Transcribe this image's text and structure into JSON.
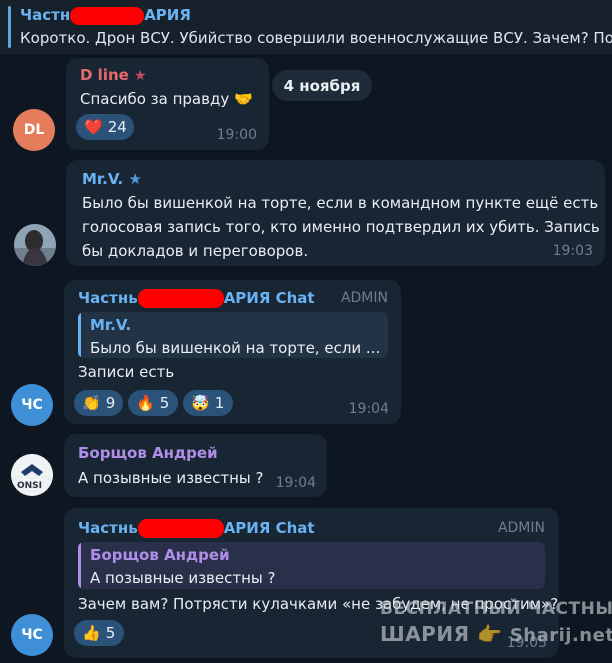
{
  "pinned": {
    "from_left": "Частн",
    "from_right": "АРИЯ",
    "text": "Коротко. Дрон ВСУ. Убийство совершили военнослужащие ВСУ.   Зачем? По"
  },
  "date_pill": "4 ноября",
  "messages": [
    {
      "avatar": "DL",
      "avatar_color": "#e57c5c",
      "sender": "D line",
      "sender_color": "#e86b6b",
      "badge": "★",
      "text": "Спасибо за правду 🤝",
      "reaction_emoji": "❤️",
      "reaction_count": "24",
      "time": "19:00"
    },
    {
      "sender": "Mr.V.",
      "sender_color": "#6ab3f3",
      "badge": "★",
      "text_lines": [
        "Было бы вишенкой на торте, если в командном пункте ещё есть",
        "голосовая запись того, кто именно подтвердил их убить. Запись",
        "бы докладов и переговоров."
      ],
      "time": "19:03"
    },
    {
      "avatar": "ЧС",
      "avatar_color": "#3f8fd6",
      "sender_left": "Частнь",
      "sender_right": "АРИЯ Chat",
      "sender_color": "#6ab3f3",
      "role": "ADMIN",
      "reply_name": "Mr.V.",
      "reply_color": "#6ab3f3",
      "reply_text": "Было бы вишенкой на торте, если ...",
      "text": "Записи есть",
      "reactions": [
        {
          "emoji": "👏",
          "count": "9"
        },
        {
          "emoji": "🔥",
          "count": "5"
        },
        {
          "emoji": "🤯",
          "count": "1"
        }
      ],
      "time": "19:04"
    },
    {
      "sender": "Борщов Андрей",
      "sender_color": "#b08ee8",
      "avatar_text": "ONSI",
      "text": "А позывные известны ?",
      "time": "19:04"
    },
    {
      "avatar": "ЧС",
      "avatar_color": "#3f8fd6",
      "sender_left": "Частнь",
      "sender_right": "АРИЯ Chat",
      "sender_color": "#6ab3f3",
      "role": "ADMIN",
      "reply_name": "Борщов Андрей",
      "reply_color": "#b08ee8",
      "reply_text": "А позывные известны ?",
      "text": "Зачем вам? Потрясти кулачками «не забудем, не простим»?",
      "reaction_emoji": "👍",
      "reaction_count": "5",
      "time": "19:05"
    }
  ],
  "watermark": {
    "line1": "БЕСПЛАТНЫЙ  ЧАСТНЫЙ",
    "line2": "ШАРИЯ",
    "site": "Sharij.net"
  }
}
